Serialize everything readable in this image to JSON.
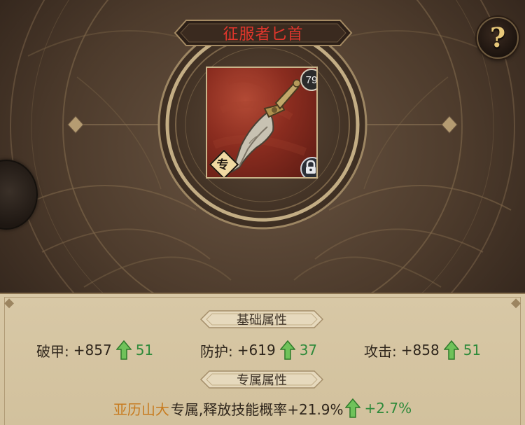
{
  "item": {
    "name": "征服者匕首",
    "level": "79",
    "exclusive_badge": "专",
    "locked": true,
    "icons": [
      "dagger-icon",
      "lock-icon",
      "help-icon"
    ]
  },
  "help": {
    "label": "?"
  },
  "base_section": {
    "title": "基础属性",
    "stats": [
      {
        "label": "破甲:",
        "value": "+857",
        "increase": "51"
      },
      {
        "label": "防护:",
        "value": "+619",
        "increase": "37"
      },
      {
        "label": "攻击:",
        "value": "+858",
        "increase": "51"
      }
    ]
  },
  "exclusive_section": {
    "title": "专属属性",
    "hero": "亚历山大",
    "text": "专属,释放技能概率+21.9%",
    "increase": "+2.7%"
  },
  "colors": {
    "title_red": "#e0362c",
    "hero_orange": "#c77a1d",
    "increase_green": "#2e8a3a",
    "panel_bg": "#d8c8a6"
  }
}
